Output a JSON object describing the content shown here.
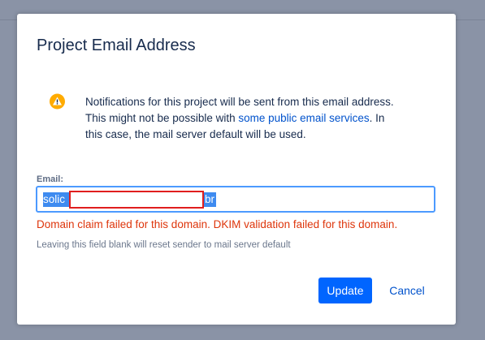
{
  "dialog": {
    "title": "Project Email Address",
    "notice": {
      "icon": "warning-icon",
      "text_before": "Notifications for this project will be sent from this email address. This might not be possible with ",
      "link": "some public email services",
      "text_after": ". In this case, the mail server default will be used."
    },
    "email": {
      "label": "Email:",
      "value_start": "solic",
      "value_end": ".br"
    },
    "error": "Domain claim failed for this domain. DKIM validation failed for this domain.",
    "hint": "Leaving this field blank will reset sender to mail server default",
    "update_label": "Update",
    "cancel_label": "Cancel"
  },
  "colors": {
    "primary": "#0065ff",
    "link": "#0052cc",
    "error": "#de350b",
    "warning": "#ffab00",
    "overlay": "#8a93a6",
    "redaction": "#e01e1e"
  }
}
